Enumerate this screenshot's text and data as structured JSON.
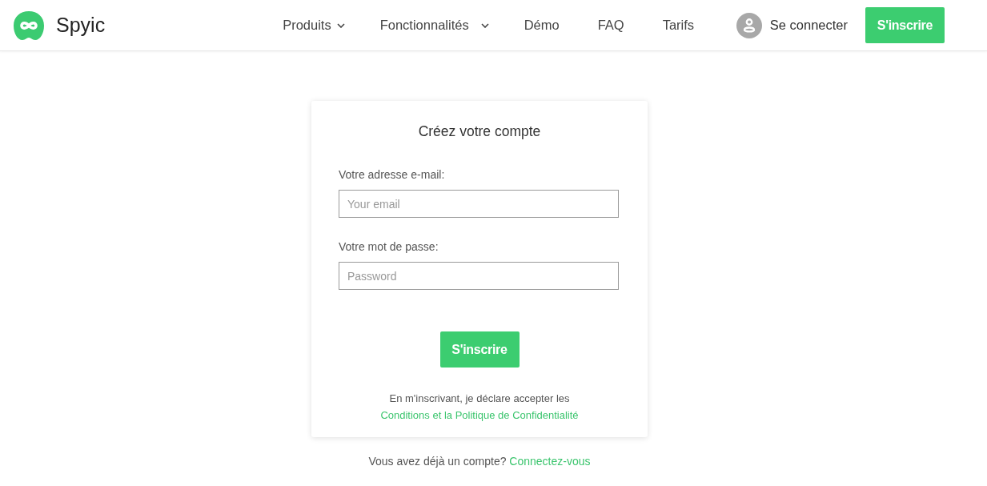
{
  "header": {
    "logo": {
      "name": "Spyic"
    },
    "nav": [
      {
        "label": "Produits",
        "dropdown": true
      },
      {
        "label": "Fonctionnalités",
        "dropdown": true
      },
      {
        "label": "Démo",
        "dropdown": false
      },
      {
        "label": "FAQ",
        "dropdown": false
      },
      {
        "label": "Tarifs",
        "dropdown": false
      }
    ],
    "login": {
      "label": "Se connecter"
    },
    "signup_button": "S'inscrire"
  },
  "form": {
    "title": "Créez votre compte",
    "fields": [
      {
        "label": "Votre adresse e-mail:",
        "placeholder": "Your email"
      },
      {
        "label": "Votre mot de passe:",
        "placeholder": "Password"
      }
    ],
    "submit": "S'inscrire",
    "terms": {
      "text": "En m'inscrivant, je déclare accepter les",
      "link": "Conditions et la Politique de Confidentialité"
    }
  },
  "footer": {
    "text": "Vous avez déjà un compte?",
    "link": "Connectez-vous"
  }
}
